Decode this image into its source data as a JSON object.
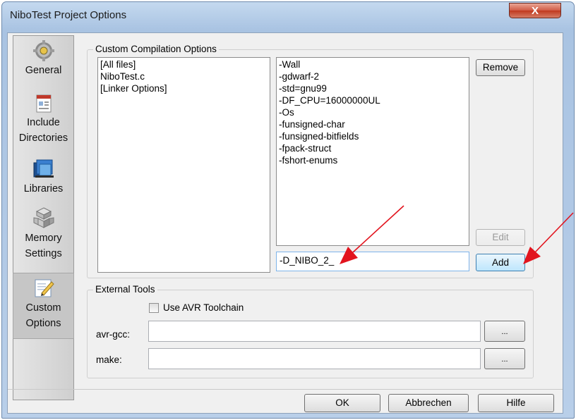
{
  "window": {
    "title": "NiboTest Project Options",
    "close_glyph": "X"
  },
  "sidebar": {
    "items": [
      {
        "label": "General",
        "icon": "gear-icon"
      },
      {
        "label": "Include Directories",
        "icon": "include-directories-icon"
      },
      {
        "label": "Libraries",
        "icon": "libraries-icon"
      },
      {
        "label": "Memory Settings",
        "icon": "memory-settings-icon"
      },
      {
        "label": "Custom Options",
        "icon": "custom-options-icon",
        "selected": true
      }
    ]
  },
  "custom_compilation": {
    "legend": "Custom Compilation Options",
    "files": [
      "[All files]",
      "NiboTest.c",
      "[Linker Options]"
    ],
    "options": [
      "-Wall",
      "-gdwarf-2",
      "-std=gnu99",
      "-DF_CPU=16000000UL",
      "-Os",
      "-funsigned-char",
      "-funsigned-bitfields",
      "-fpack-struct",
      "-fshort-enums"
    ],
    "new_option_value": "-D_NIBO_2_",
    "remove_label": "Remove",
    "edit_label": "Edit",
    "add_label": "Add"
  },
  "external_tools": {
    "legend": "External Tools",
    "use_avr_toolchain_label": "Use AVR Toolchain",
    "use_avr_toolchain_checked": false,
    "avr_gcc_label": "avr-gcc:",
    "avr_gcc_value": "",
    "make_label": "make:",
    "make_value": "",
    "browse_label": "..."
  },
  "footer": {
    "ok_label": "OK",
    "cancel_label": "Abbrechen",
    "help_label": "Hilfe"
  },
  "colors": {
    "annotation_arrow": "#e2141e",
    "close_button": "#c0391f"
  }
}
